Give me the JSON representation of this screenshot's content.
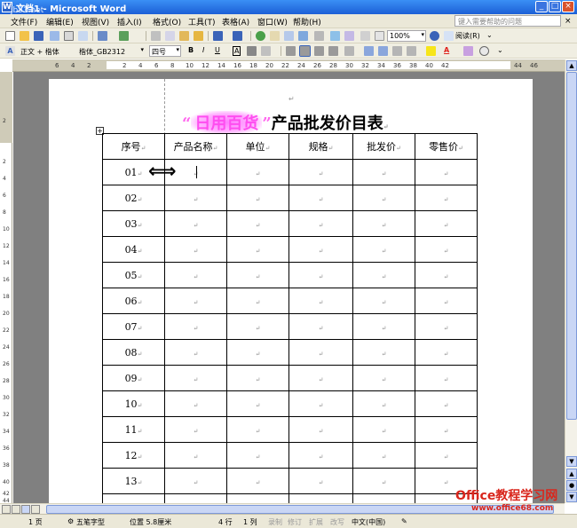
{
  "window": {
    "title": "文档1 - Microsoft Word",
    "watermark": "jb51.net",
    "min": "_",
    "max": "□",
    "close": "×"
  },
  "menu": {
    "items": [
      "文件(F)",
      "编辑(E)",
      "视图(V)",
      "插入(I)",
      "格式(O)",
      "工具(T)",
      "表格(A)",
      "窗口(W)",
      "帮助(H)"
    ],
    "help_placeholder": "键入需要帮助的问题",
    "close": "×"
  },
  "toolbar": {
    "zoom": "100%",
    "read": "阅读(R)",
    "style": "正文 + 楷体",
    "font": "楷体_GB2312",
    "size": "四号",
    "bold": "B",
    "italic": "I",
    "underline": "U",
    "char_border": "A",
    "font_color": "A",
    "colors": {
      "highlight": "#f7e51a",
      "font_color": "#e0201b",
      "accent": "#2b63c9"
    }
  },
  "ruler": {
    "h_ticks": [
      "6",
      "4",
      "2",
      "2",
      "4",
      "6",
      "8",
      "10",
      "12",
      "14",
      "16",
      "18",
      "20",
      "22",
      "24",
      "26",
      "28",
      "30",
      "32",
      "34",
      "36",
      "38",
      "40",
      "42",
      "44",
      "46"
    ],
    "v_ticks": [
      "2",
      "2",
      "4",
      "6",
      "8",
      "10",
      "12",
      "14",
      "16",
      "18",
      "20",
      "22",
      "24",
      "26",
      "28",
      "30",
      "32",
      "34",
      "36",
      "38",
      "40",
      "42",
      "44"
    ]
  },
  "document": {
    "title_quote_open": "“",
    "title_highlight": "日用百货",
    "title_quote_close": "”",
    "title_rest": "产品批发价目表",
    "cell_mark": "↵",
    "table": {
      "headers": [
        "序号",
        "产品名称",
        "单位",
        "规格",
        "批发价",
        "零售价"
      ],
      "rows": [
        "01",
        "02",
        "03",
        "04",
        "05",
        "06",
        "07",
        "08",
        "09",
        "10",
        "11",
        "12",
        "13",
        ""
      ]
    },
    "drag_cursor": "⟺"
  },
  "status": {
    "page": "1 页",
    "input_method": "五笔字型",
    "position": "位置 5.8厘米",
    "line": "4 行",
    "column": "1 列",
    "rec": "录制",
    "trk": "修订",
    "ext": "扩展",
    "ovr": "改写",
    "language": "中文(中国)"
  },
  "site": {
    "name": "Office教程学习网",
    "url": "www.office68.com"
  }
}
